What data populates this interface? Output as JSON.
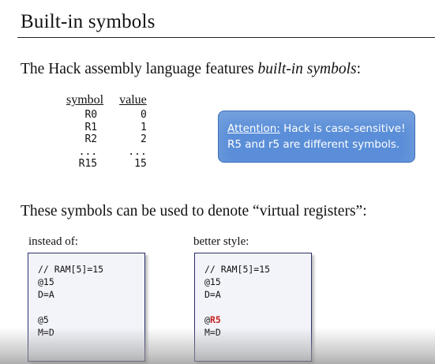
{
  "title": "Built-in symbols",
  "intro": {
    "text": "The Hack assembly language features ",
    "emph": "built-in symbols",
    "end": ":"
  },
  "table": {
    "headers": [
      "symbol",
      "value"
    ],
    "rows": [
      [
        "R0",
        "0"
      ],
      [
        "R1",
        "1"
      ],
      [
        "R2",
        "2"
      ],
      [
        "...",
        "..."
      ],
      [
        "R15",
        "15"
      ]
    ]
  },
  "attention": {
    "label": "Attention:",
    "line1": " Hack is case-sensitive!",
    "line2": "R5 and r5 are different symbols.",
    "color": "#5a8ed8"
  },
  "virtual_text": "These symbols can be used to denote “virtual registers”:",
  "left": {
    "caption": "instead of:",
    "lines": [
      "// RAM[5]=15",
      "@15",
      "D=A",
      "",
      "@5",
      "M=D"
    ]
  },
  "right": {
    "caption": "better style:",
    "lines": [
      "// RAM[5]=15",
      "@15",
      "D=A",
      "",
      "@",
      "M=D"
    ],
    "highlight": "R5",
    "highlight_color": "#c62020"
  }
}
